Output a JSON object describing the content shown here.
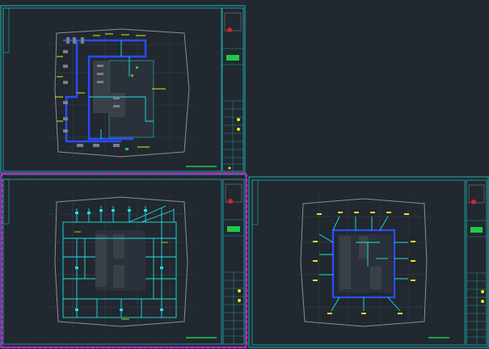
{
  "app": {
    "background": "#212830",
    "frame_color": "#1fb4b4",
    "selection_color": "#d21ed2"
  },
  "sheets": [
    {
      "name": "sheet-top-left",
      "kind": "floor-plan-supply",
      "selected": false,
      "stamp_icon": "red-seal-icon"
    },
    {
      "name": "sheet-bottom-left",
      "kind": "floor-plan-wiring",
      "selected": true,
      "stamp_icon": "red-seal-icon"
    },
    {
      "name": "sheet-bottom-right",
      "kind": "floor-plan-core",
      "selected": false,
      "stamp_icon": "red-seal-icon"
    }
  ],
  "palette": {
    "wall": "#8a8f95",
    "pipe_blue": "#2a4cff",
    "pipe_cyan": "#21e0e0",
    "label_yellow": "#e8e81e",
    "green": "#22c84a",
    "core_gray": "#3a4048",
    "seal_red": "#d4262a"
  }
}
